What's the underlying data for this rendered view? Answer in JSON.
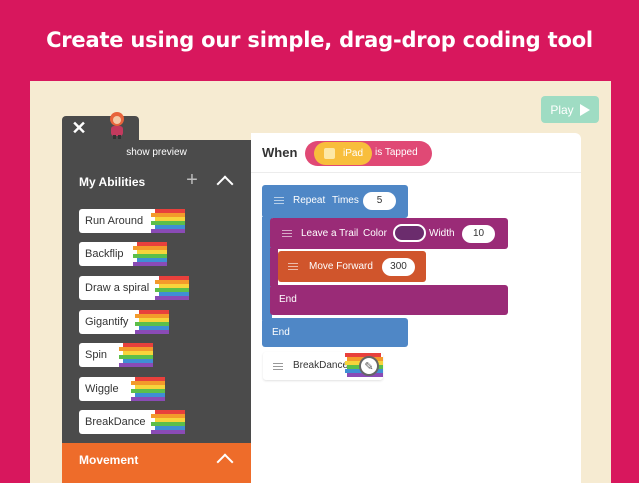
{
  "headline": "Create using our simple, drag-drop coding tool",
  "play_button": {
    "label": "Play"
  },
  "panel": {
    "show_preview": "show preview",
    "abilities_title": "My Abilities",
    "abilities": [
      "Run Around",
      "Backflip",
      "Draw a spiral",
      "Gigantify",
      "Spin",
      "Wiggle",
      "BreakDance"
    ],
    "movement_title": "Movement"
  },
  "script": {
    "when_label": "When",
    "trigger": "iPad",
    "trigger_event": "is Tapped",
    "repeat": {
      "label": "Repeat",
      "times": "Times",
      "value": "5"
    },
    "trail": {
      "label": "Leave a Trail",
      "color_label": "Color",
      "width_label": "Width",
      "width_value": "10"
    },
    "move": {
      "label": "Move Forward",
      "value": "300"
    },
    "inner_end": "End",
    "outer_end": "End",
    "breakdance": {
      "label": "BreakDance"
    }
  },
  "colors": {
    "page_bg": "#d8175d",
    "canvas_bg": "#f6ebd2",
    "panel_bg": "#4b4b4b",
    "movement": "#ee6c2a",
    "repeat_block": "#4f87c6",
    "trail_block": "#9a2b77",
    "move_block": "#d0552c",
    "event_pill": "#e04975",
    "ipad_pill": "#f8be3c",
    "play_button": "#9fdcc3"
  }
}
